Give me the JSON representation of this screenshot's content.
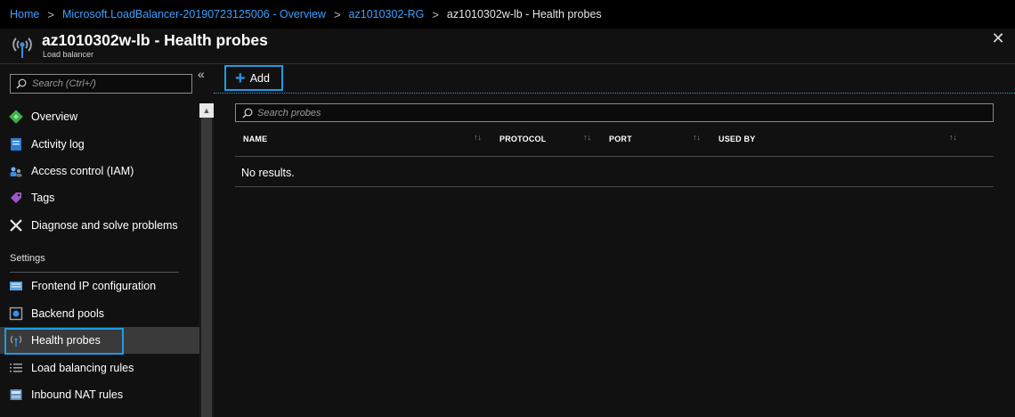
{
  "breadcrumb": {
    "items": [
      "Home",
      "Microsoft.LoadBalancer-20190723125006 - Overview",
      "az1010302-RG"
    ],
    "separator": ">",
    "current": "az1010302w-lb - Health probes"
  },
  "blade": {
    "title": "az1010302w-lb - Health probes",
    "subtitle": "Load balancer",
    "close_icon": "close-icon"
  },
  "sidebar": {
    "collapse_label": "«",
    "search": {
      "placeholder": "Search (Ctrl+/)"
    },
    "items": [
      {
        "label": "Overview",
        "icon": "overview-icon"
      },
      {
        "label": "Activity log",
        "icon": "activity-log-icon"
      },
      {
        "label": "Access control (IAM)",
        "icon": "iam-icon"
      },
      {
        "label": "Tags",
        "icon": "tag-icon"
      },
      {
        "label": "Diagnose and solve problems",
        "icon": "wrench-icon"
      }
    ],
    "section_settings": "Settings",
    "settings_items": [
      {
        "label": "Frontend IP configuration",
        "icon": "frontend-ip-icon"
      },
      {
        "label": "Backend pools",
        "icon": "backend-pool-icon"
      },
      {
        "label": "Health probes",
        "icon": "health-probe-icon",
        "active": true
      },
      {
        "label": "Load balancing rules",
        "icon": "lb-rules-icon"
      },
      {
        "label": "Inbound NAT rules",
        "icon": "nat-rules-icon"
      }
    ]
  },
  "toolbar": {
    "add_label": "Add"
  },
  "probes": {
    "search": {
      "placeholder": "Search probes"
    },
    "columns": [
      "NAME",
      "PROTOCOL",
      "PORT",
      "USED BY"
    ],
    "sort_glyph": "↑↓",
    "empty_text": "No results."
  },
  "colors": {
    "accent": "#1e9be6",
    "link": "#3aa0ff",
    "background": "#111111",
    "active_item": "#3a3a3a"
  }
}
